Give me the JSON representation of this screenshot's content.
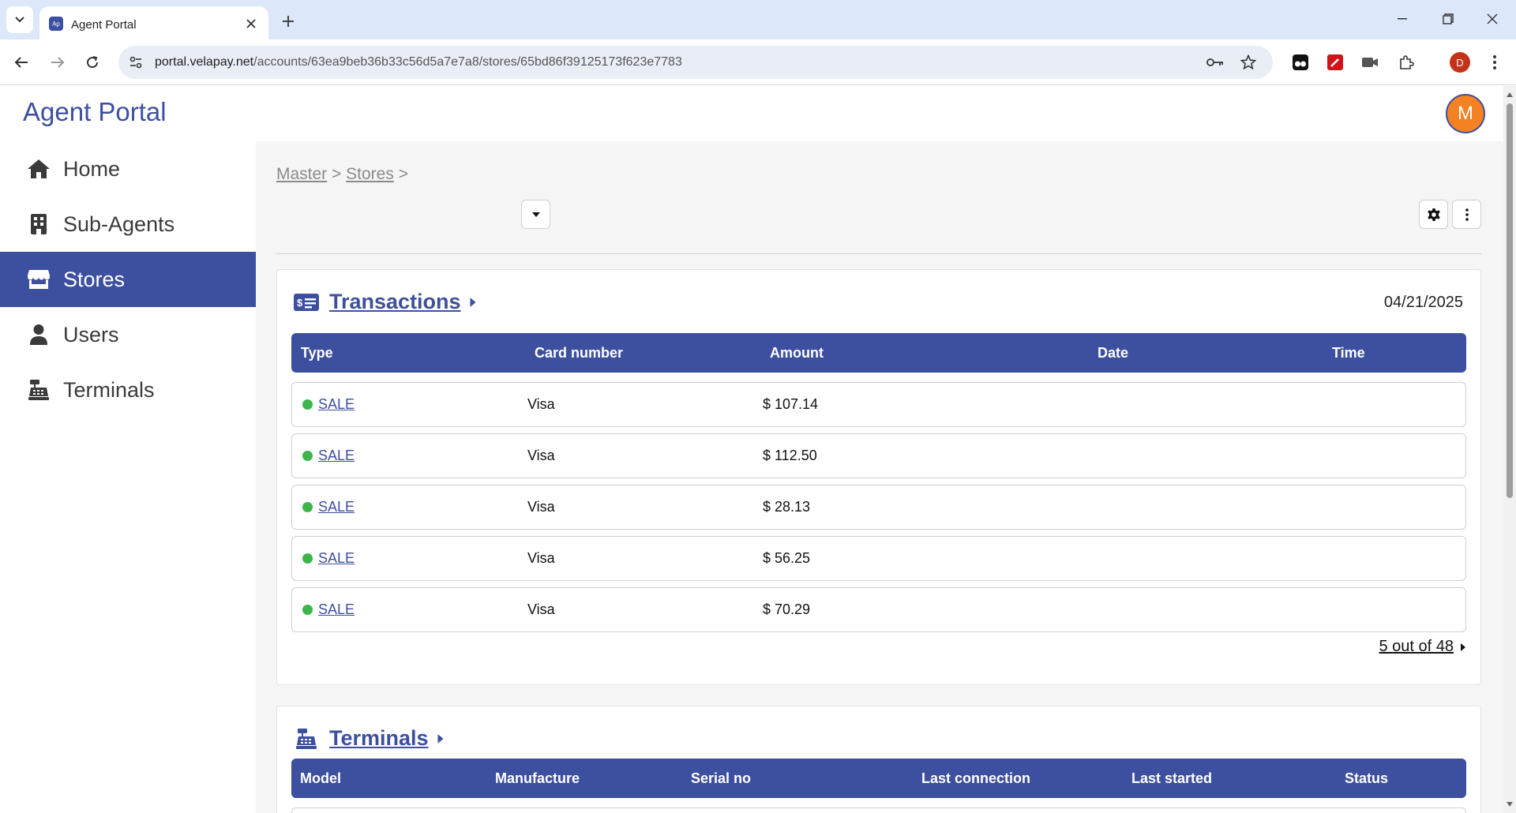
{
  "browser": {
    "tab_title": "Agent Portal",
    "url_host": "portal.velapay.net",
    "url_path": "/accounts/63ea9beb36b33c56d5a7e7a8/stores/65bd86f39125173f623e7783",
    "profile_initial": "D"
  },
  "app": {
    "brand": "Agent Portal",
    "avatar_initial": "M",
    "accent_color": "#3d4f9f",
    "avatar_color": "#f48122"
  },
  "sidebar": {
    "items": [
      {
        "label": "Home",
        "icon": "home-icon"
      },
      {
        "label": "Sub-Agents",
        "icon": "building-icon"
      },
      {
        "label": "Stores",
        "icon": "store-icon",
        "active": true
      },
      {
        "label": "Users",
        "icon": "user-icon"
      },
      {
        "label": "Terminals",
        "icon": "cash-register-icon"
      }
    ]
  },
  "breadcrumb": {
    "master": "Master",
    "sep1": ">",
    "stores": "Stores",
    "sep2": ">"
  },
  "transactions": {
    "title": "Transactions",
    "date": "04/21/2025",
    "columns": [
      "Type",
      "Card number",
      "Amount",
      "Date",
      "Time"
    ],
    "rows": [
      {
        "type": "SALE",
        "card": "Visa",
        "amount": "$ 107.14",
        "date": "",
        "time": ""
      },
      {
        "type": "SALE",
        "card": "Visa",
        "amount": "$ 112.50",
        "date": "",
        "time": ""
      },
      {
        "type": "SALE",
        "card": "Visa",
        "amount": "$ 28.13",
        "date": "",
        "time": ""
      },
      {
        "type": "SALE",
        "card": "Visa",
        "amount": "$ 56.25",
        "date": "",
        "time": ""
      },
      {
        "type": "SALE",
        "card": "Visa",
        "amount": "$ 70.29",
        "date": "",
        "time": ""
      }
    ],
    "status_color": "#3db54a",
    "pager": "5 out of 48"
  },
  "terminals": {
    "title": "Terminals",
    "columns": [
      "Model",
      "Manufacture",
      "Serial no",
      "Last connection",
      "Last started",
      "Status"
    ]
  }
}
